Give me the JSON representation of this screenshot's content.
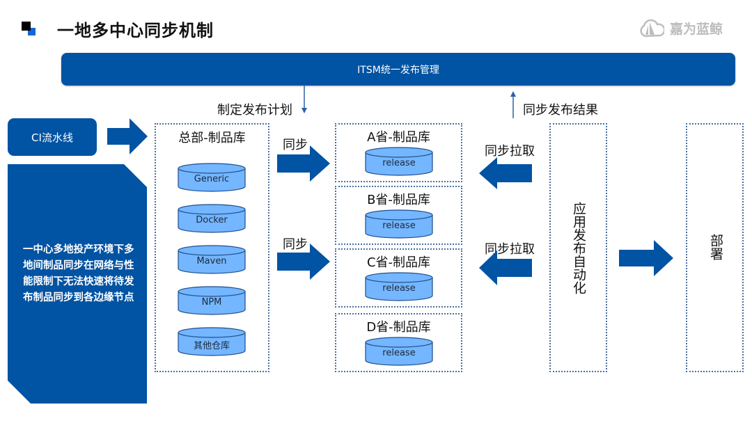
{
  "header": {
    "title": "一地多中心同步机制",
    "brand": "嘉为蓝鲸",
    "brand_icon": "cloud-sail-logo-icon"
  },
  "colors": {
    "primary": "#0153a3",
    "cylinder_fill": "#74b6ff",
    "cylinder_stroke": "#1d4d8a",
    "dashed_border": "#4a6e9e",
    "brand_gray": "#bdbdbd"
  },
  "itsm_bar": {
    "label": "ITSM统一发布管理"
  },
  "annotations": {
    "plan": "制定发布计划",
    "result": "同步发布结果"
  },
  "ci_pipeline": {
    "label": "CI流水线"
  },
  "note": {
    "text": "一中心多地投产环境下多地间制品同步在网络与性能限制下无法快速将待发布制品同步到各边缘节点"
  },
  "headquarters": {
    "title": "总部-制品库",
    "repos": [
      "Generic",
      "Docker",
      "Maven",
      "NPM",
      "其他仓库"
    ]
  },
  "sync_arrows": [
    {
      "label": "同步",
      "icon": "arrow-right-icon"
    },
    {
      "label": "同步",
      "icon": "arrow-right-icon"
    }
  ],
  "provinces": [
    {
      "title": "A省-制品库",
      "repo": "release"
    },
    {
      "title": "B省-制品库",
      "repo": "release"
    },
    {
      "title": "C省-制品库",
      "repo": "release"
    },
    {
      "title": "D省-制品库",
      "repo": "release"
    }
  ],
  "pull_arrows": [
    {
      "label": "同步拉取",
      "icon": "arrow-left-icon"
    },
    {
      "label": "同步拉取",
      "icon": "arrow-left-icon"
    }
  ],
  "automation": {
    "label": "应用发布自动化"
  },
  "deploy": {
    "label": "部署"
  }
}
